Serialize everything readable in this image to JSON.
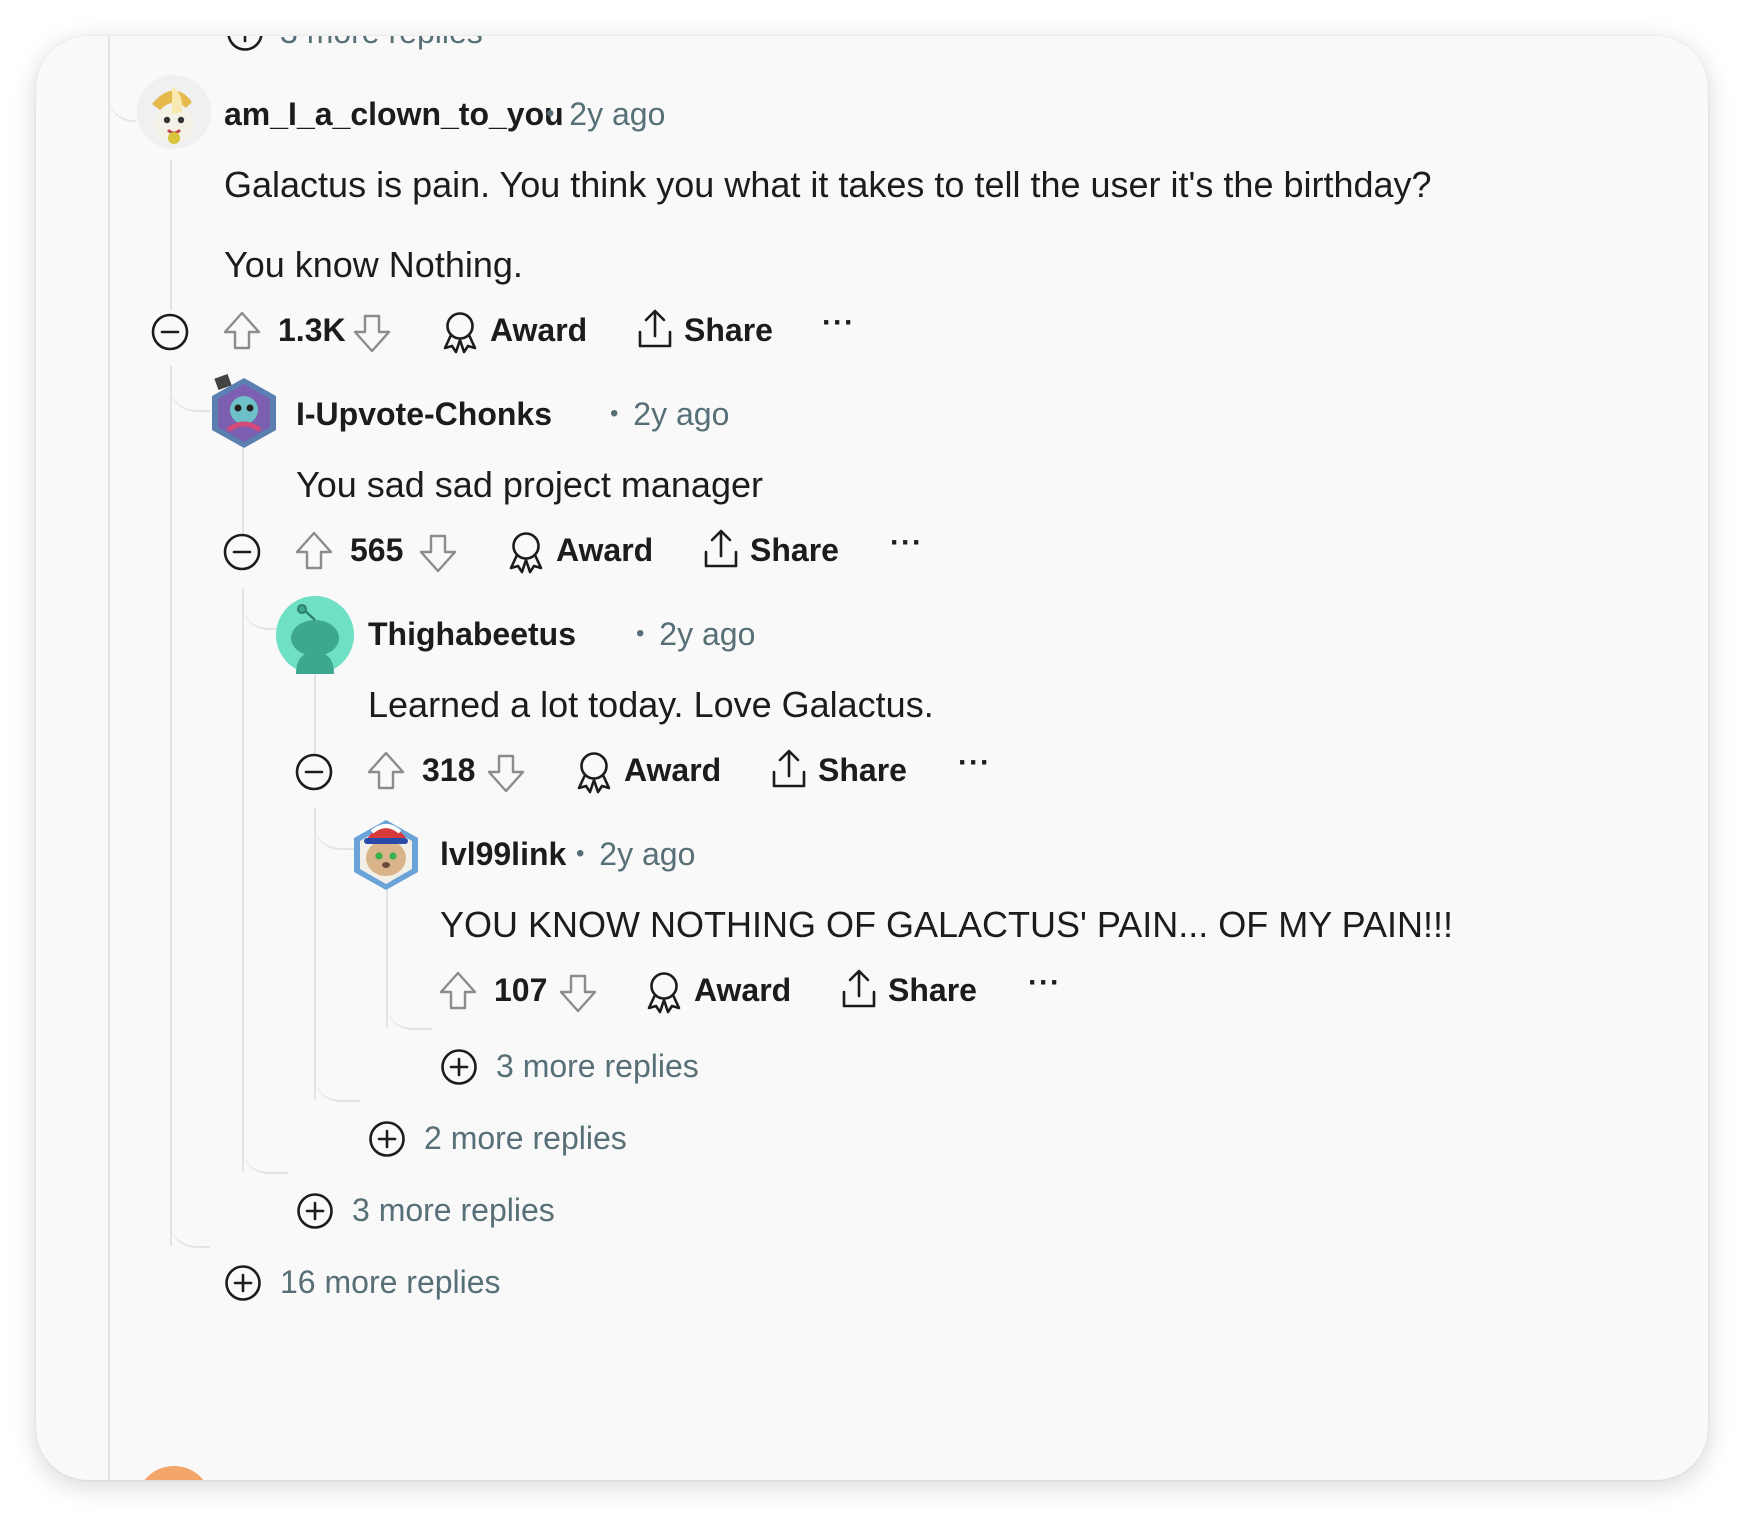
{
  "comments": [
    {
      "user": "am_I_a_clown_to_you",
      "time": "2y ago",
      "body": [
        "Galactus is pain. You think you what it takes to tell the user it's the birthday?",
        "You know Nothing."
      ],
      "score": "1.3K"
    },
    {
      "user": "I-Upvote-Chonks",
      "time": "2y ago",
      "body": [
        "You sad sad project manager"
      ],
      "score": "565"
    },
    {
      "user": "Thighabeetus",
      "time": "2y ago",
      "body": [
        "Learned a lot today. Love Galactus."
      ],
      "score": "318"
    },
    {
      "user": "lvl99link",
      "time": "2y ago",
      "body": [
        "YOU KNOW NOTHING OF GALACTUS' PAIN... OF MY PAIN!!!"
      ],
      "score": "107"
    }
  ],
  "actions": {
    "award": "Award",
    "share": "Share",
    "more": "···",
    "separator": "•"
  },
  "more_replies": {
    "top": "3 more replies",
    "level4": "3 more replies",
    "level3": "2 more replies",
    "level2": "3 more replies",
    "level1": "16 more replies"
  },
  "icons": [
    "collapse-icon",
    "expand-icon",
    "upvote-icon",
    "downvote-icon",
    "award-icon",
    "share-icon",
    "overflow-icon"
  ],
  "colors": {
    "text": "#1c1c1c",
    "meta": "#576f76",
    "thread_line": "#e2e4e6",
    "card_bg": "#f9f9f9"
  }
}
